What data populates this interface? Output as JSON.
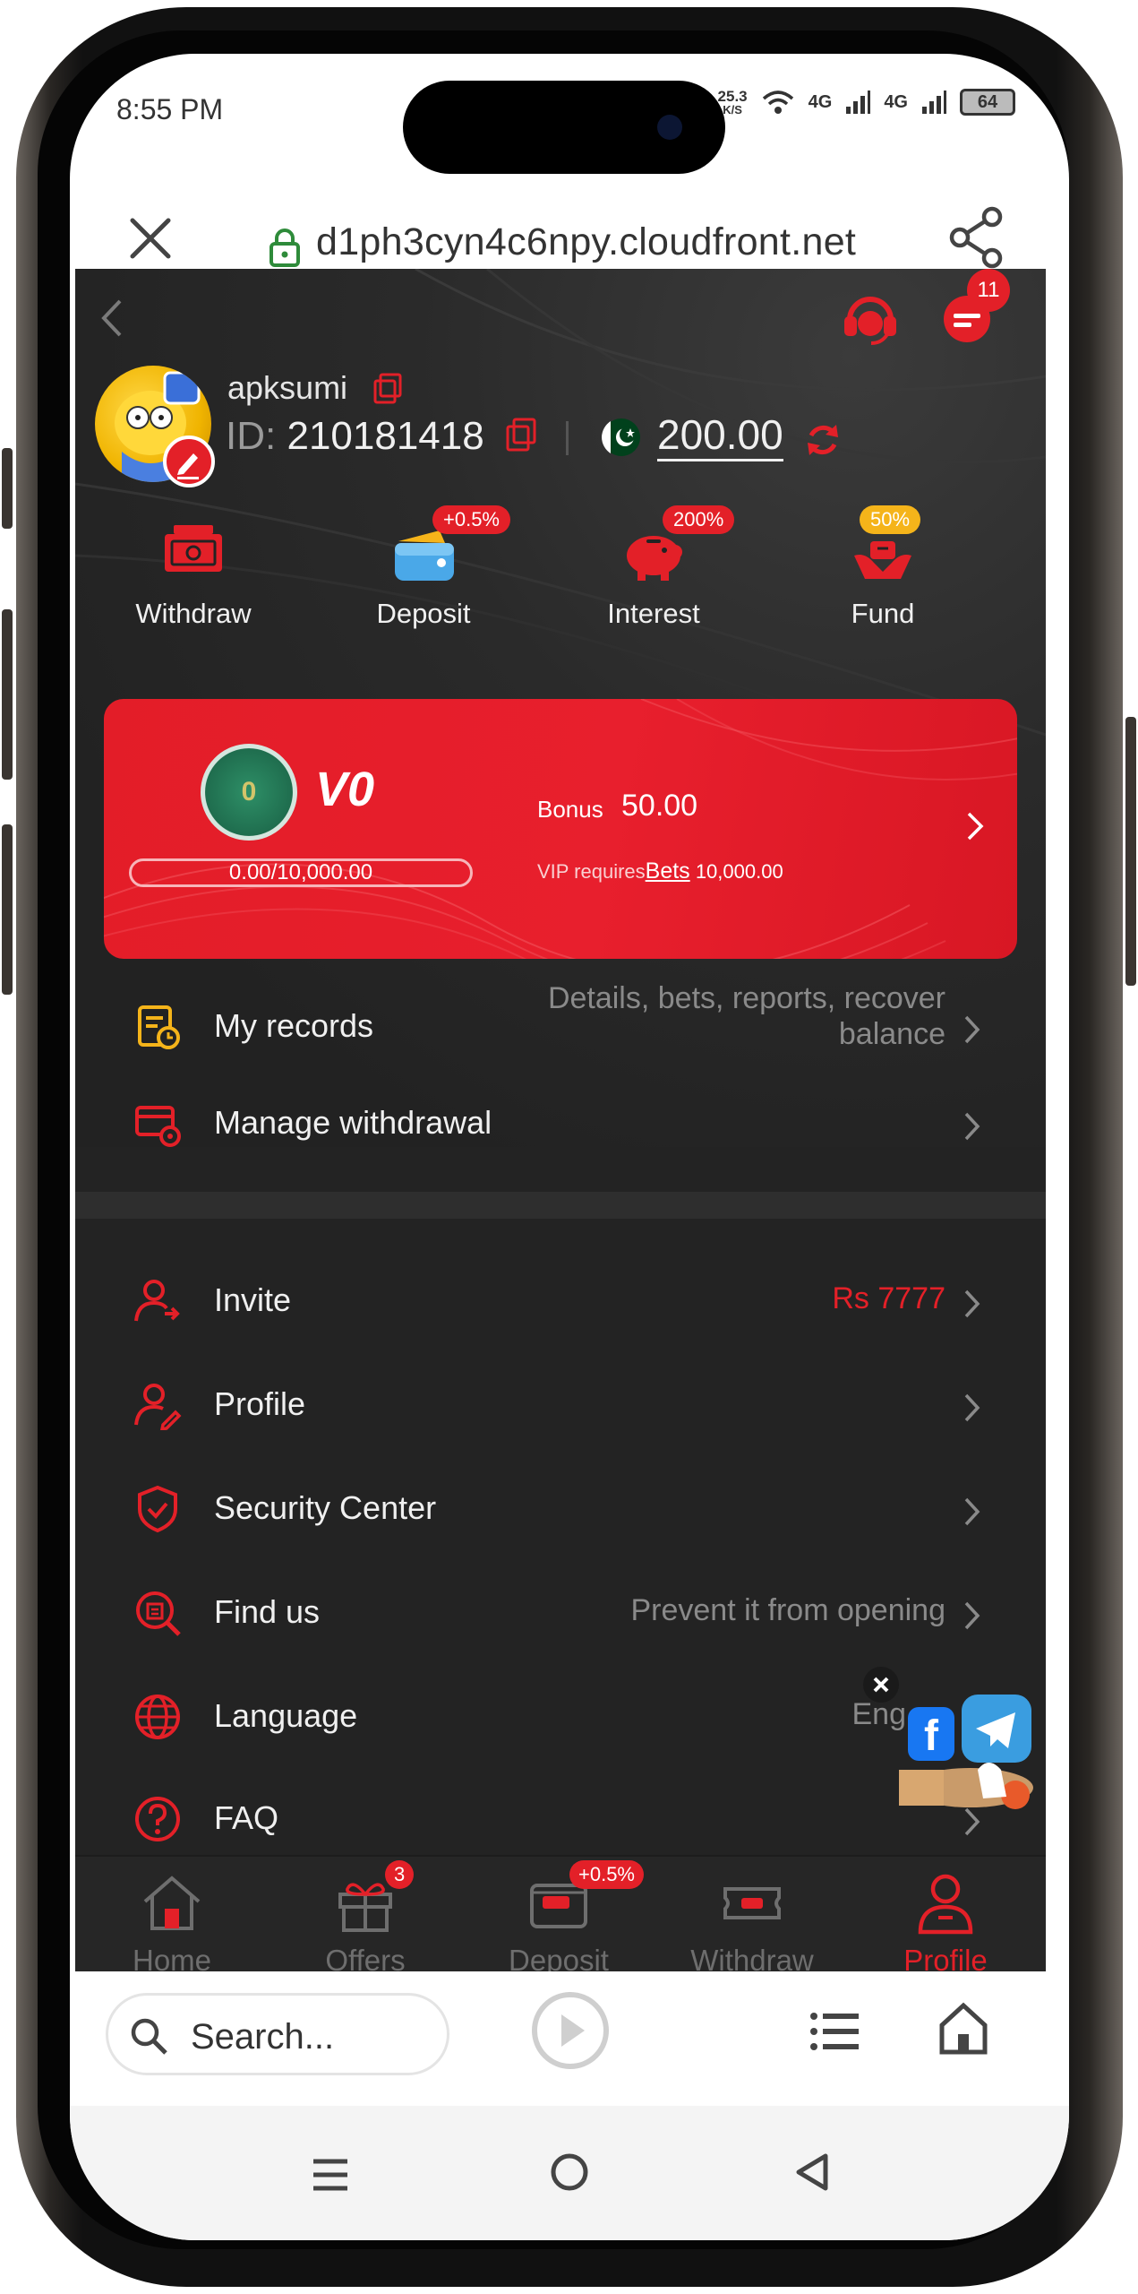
{
  "status_bar": {
    "time": "8:55 PM",
    "speed_value": "25.3",
    "speed_unit": "K/S",
    "net1": "4G",
    "net2": "4G",
    "battery": "64"
  },
  "browser": {
    "url": "d1ph3cyn4c6npy.cloudfront.net",
    "search_placeholder": "Search..."
  },
  "header": {
    "message_count": "11"
  },
  "user": {
    "username": "apksumi",
    "id_label": "ID:",
    "id_value": "210181418",
    "balance": "200.00"
  },
  "quick_actions": [
    {
      "label": "Withdraw",
      "badge": "",
      "icon": "withdraw-ticket-icon"
    },
    {
      "label": "Deposit",
      "badge": "+0.5%",
      "icon": "wallet-icon"
    },
    {
      "label": "Interest",
      "badge": "200%",
      "icon": "piggy-bank-icon"
    },
    {
      "label": "Fund",
      "badge": "50%",
      "icon": "fund-hands-icon"
    }
  ],
  "vip": {
    "medal_level": "0",
    "level": "V0",
    "progress_text": "0.00/10,000.00",
    "progress_fraction": 0,
    "bonus_label": "Bonus",
    "bonus_value": "50.00",
    "requires_text": "VIP requires",
    "bets_link": "Bets",
    "requires_amount": "10,000.00"
  },
  "menu_top": [
    {
      "label": "My records",
      "value_line1": "Details, bets, reports, recover",
      "value_line2": "balance",
      "icon": "records-icon"
    },
    {
      "label": "Manage withdrawal",
      "value": "",
      "icon": "manage-withdrawal-icon"
    }
  ],
  "menu_bottom": [
    {
      "label": "Invite",
      "value": "Rs 7777",
      "icon": "invite-user-icon"
    },
    {
      "label": "Profile",
      "value": "",
      "icon": "profile-edit-icon"
    },
    {
      "label": "Security Center",
      "value": "",
      "icon": "shield-icon"
    },
    {
      "label": "Find us",
      "value": "Prevent it from opening",
      "icon": "find-us-icon"
    },
    {
      "label": "Language",
      "value": "Eng",
      "icon": "globe-icon"
    },
    {
      "label": "FAQ",
      "value": "",
      "icon": "question-icon"
    }
  ],
  "tabbar": [
    {
      "label": "Home",
      "badge": ""
    },
    {
      "label": "Offers",
      "badge": "3"
    },
    {
      "label": "Deposit",
      "badge": "+0.5%"
    },
    {
      "label": "Withdraw",
      "badge": ""
    },
    {
      "label": "Profile",
      "badge": ""
    }
  ],
  "colors": {
    "accent": "#e32028",
    "background": "#232323",
    "gold": "#f5b41a"
  }
}
